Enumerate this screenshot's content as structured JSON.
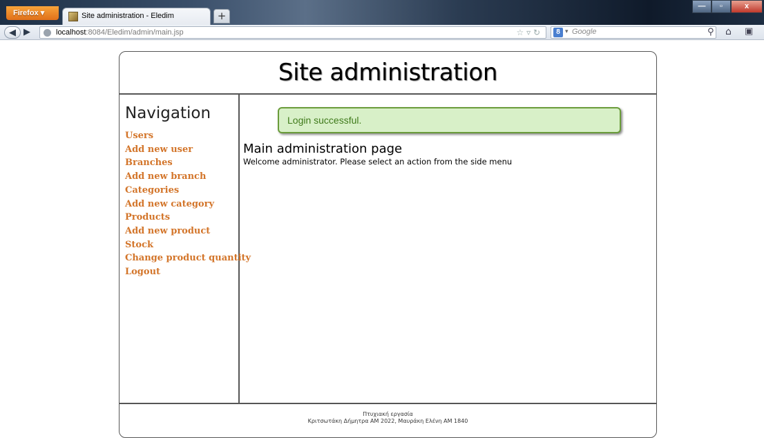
{
  "browser": {
    "menu_label": "Firefox",
    "tab_title": "Site administration - Eledim",
    "newtab_label": "+",
    "url_host": "localhost",
    "url_rest": ":8084/Eledim/admin/main.jsp",
    "search_placeholder": "Google",
    "search_engine_letter": "8"
  },
  "page": {
    "title": "Site administration",
    "navigation": {
      "title": "Navigation",
      "items": [
        "Users",
        "Add new user",
        "Branches",
        "Add new branch",
        "Categories",
        "Add new category",
        "Products",
        "Add new product",
        "Stock",
        "Change product quantity",
        "Logout"
      ]
    },
    "alert": "Login successful.",
    "main_title": "Main administration page",
    "main_text": "Welcome administrator. Please select an action from the side menu",
    "footer": {
      "line1": "Πτυχιακή εργασία",
      "line2": "Κριτσωτάκη Δήμητρα ΑΜ 2022, Μαυράκη Ελένη ΑΜ 1840"
    }
  },
  "colors": {
    "nav_link": "#d3752a",
    "alert_bg": "#d8f0c8",
    "alert_border": "#6a9c3a",
    "alert_text": "#3f7a1a"
  }
}
